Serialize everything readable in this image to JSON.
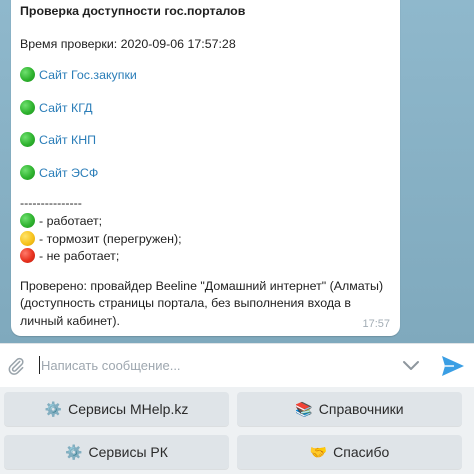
{
  "message": {
    "title": "Проверка доступности гос.порталов",
    "check_time": "Время проверки: 2020-09-06 17:57:28",
    "sites": [
      {
        "status": "green",
        "label": "Сайт Гос.закупки"
      },
      {
        "status": "green",
        "label": "Сайт КГД"
      },
      {
        "status": "green",
        "label": "Сайт КНП"
      },
      {
        "status": "green",
        "label": "Сайт ЭСФ"
      }
    ],
    "separator": "---------------",
    "legend": [
      {
        "status": "green",
        "label": "- работает;"
      },
      {
        "status": "yellow",
        "label": "- тормозит (перегружен);"
      },
      {
        "status": "red",
        "label": "- не работает;"
      }
    ],
    "note_lines": [
      "Проверено: провайдер Beeline \"Домашний интернет\" (Алматы)",
      "(доступность страницы портала, без выполнения входа в",
      "личный кабинет)."
    ],
    "time": "17:57"
  },
  "composer": {
    "placeholder": "Написать сообщение..."
  },
  "keyboard": {
    "buttons": [
      {
        "emoji": "⚙️",
        "label": "Сервисы MHelp.kz"
      },
      {
        "emoji": "📚",
        "label": "Справочники"
      },
      {
        "emoji": "⚙️",
        "label": "Сервисы РК"
      },
      {
        "emoji": "🤝",
        "label": "Спасибо"
      }
    ]
  },
  "colors": {
    "green": "#2fb32f",
    "yellow": "#f7c31e",
    "red": "#e8321f",
    "link": "#2a7db8",
    "send": "#3a9ee4"
  }
}
